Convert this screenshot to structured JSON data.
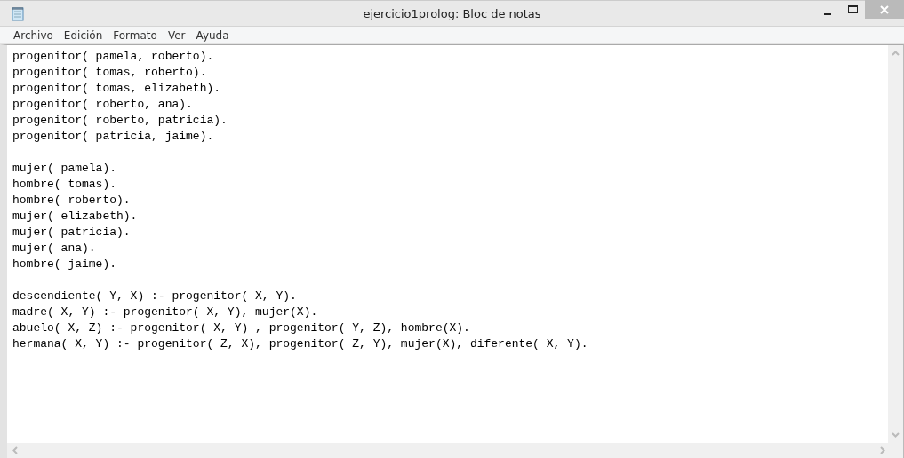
{
  "window": {
    "title": "ejercicio1prolog: Bloc de notas"
  },
  "menu": [
    "Archivo",
    "Edición",
    "Formato",
    "Ver",
    "Ayuda"
  ],
  "editor": {
    "blocks": [
      [
        "progenitor( pamela, roberto).",
        "progenitor( tomas, roberto).",
        "progenitor( tomas, elizabeth).",
        "progenitor( roberto, ana).",
        "progenitor( roberto, patricia).",
        "progenitor( patricia, jaime)."
      ],
      [
        "mujer( pamela).",
        "hombre( tomas).",
        "hombre( roberto).",
        "mujer( elizabeth).",
        "mujer( patricia).",
        "mujer( ana).",
        "hombre( jaime)."
      ],
      [
        "descendiente( Y, X) :- progenitor( X, Y).",
        "madre( X, Y) :- progenitor( X, Y), mujer(X).",
        "abuelo( X, Z) :- progenitor( X, Y) , progenitor( Y, Z), hombre(X).",
        "hermana( X, Y) :- progenitor( Z, X), progenitor( Z, Y), mujer(X), diferente( X, Y)."
      ]
    ]
  }
}
